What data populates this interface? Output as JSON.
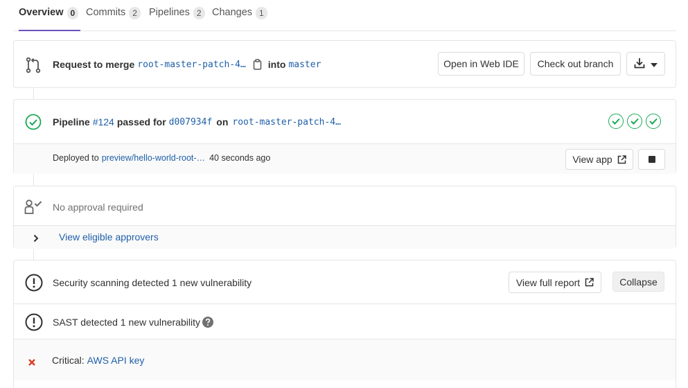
{
  "tabs": [
    {
      "label": "Overview",
      "count": "0"
    },
    {
      "label": "Commits",
      "count": "2"
    },
    {
      "label": "Pipelines",
      "count": "2"
    },
    {
      "label": "Changes",
      "count": "1"
    }
  ],
  "merge": {
    "prefix": "Request to merge",
    "source_branch": "root-master-patch-4…",
    "into": "into",
    "target_branch": "master",
    "open_web_ide": "Open in Web IDE",
    "checkout_branch": "Check out branch"
  },
  "pipeline": {
    "label": "Pipeline",
    "id": "#124",
    "passed_for": "passed for",
    "commit": "d007934f",
    "on": "on",
    "branch": "root-master-patch-4…",
    "stage_count": 3
  },
  "deploy": {
    "prefix": "Deployed to",
    "env": "preview/hello-world-root-…",
    "time": "40 seconds ago",
    "view_app": "View app"
  },
  "approval": {
    "status": "No approval required",
    "eligible": "View eligible approvers"
  },
  "security": {
    "summary": "Security scanning detected 1 new vulnerability",
    "view_full_report": "View full report",
    "collapse": "Collapse",
    "sast": "SAST detected 1 new vulnerability",
    "severity": "Critical:",
    "finding": "AWS API key"
  },
  "colors": {
    "success": "#1aaa55",
    "critical": "#db3b21",
    "link": "#1f5fa8",
    "active_tab": "#6b4fbb"
  }
}
